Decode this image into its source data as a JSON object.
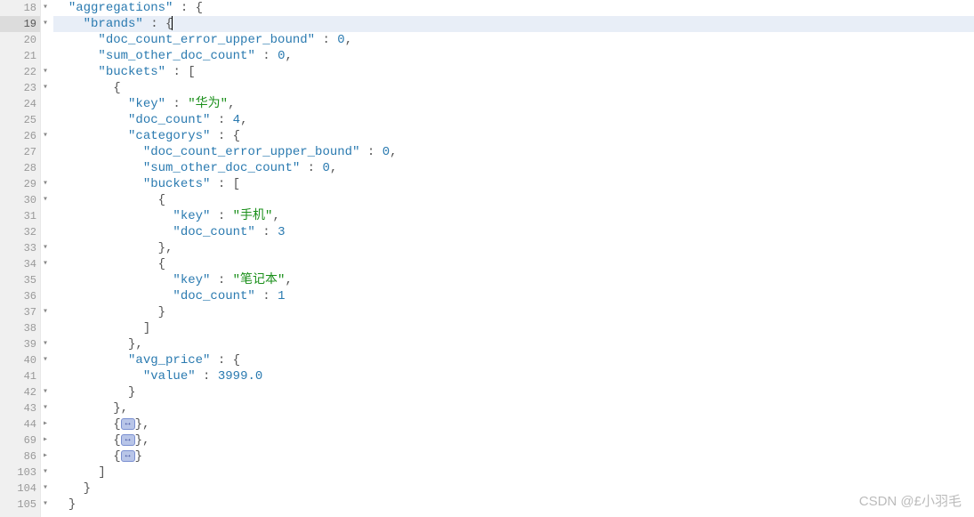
{
  "watermark": "CSDN @£小羽毛",
  "fold_badge": "↔",
  "gutter": [
    {
      "num": "18",
      "fold": "▾"
    },
    {
      "num": "19",
      "fold": "▾",
      "active": true
    },
    {
      "num": "20"
    },
    {
      "num": "21"
    },
    {
      "num": "22",
      "fold": "▾"
    },
    {
      "num": "23",
      "fold": "▾"
    },
    {
      "num": "24"
    },
    {
      "num": "25"
    },
    {
      "num": "26",
      "fold": "▾"
    },
    {
      "num": "27"
    },
    {
      "num": "28"
    },
    {
      "num": "29",
      "fold": "▾"
    },
    {
      "num": "30",
      "fold": "▾"
    },
    {
      "num": "31"
    },
    {
      "num": "32"
    },
    {
      "num": "33",
      "fold": "▾"
    },
    {
      "num": "34",
      "fold": "▾"
    },
    {
      "num": "35"
    },
    {
      "num": "36"
    },
    {
      "num": "37",
      "fold": "▾"
    },
    {
      "num": "38"
    },
    {
      "num": "39",
      "fold": "▾"
    },
    {
      "num": "40",
      "fold": "▾"
    },
    {
      "num": "41"
    },
    {
      "num": "42",
      "fold": "▾"
    },
    {
      "num": "43",
      "fold": "▾"
    },
    {
      "num": "44",
      "fold": "▸"
    },
    {
      "num": "69",
      "fold": "▸"
    },
    {
      "num": "86",
      "fold": "▸"
    },
    {
      "num": "103",
      "fold": "▾"
    },
    {
      "num": "104",
      "fold": "▾"
    },
    {
      "num": "105",
      "fold": "▾"
    }
  ],
  "lines": [
    {
      "indent": 2,
      "tokens": [
        [
          "key",
          "\"aggregations\""
        ],
        [
          "punc",
          " : {"
        ]
      ]
    },
    {
      "indent": 4,
      "active": true,
      "tokens": [
        [
          "key",
          "\"brands\""
        ],
        [
          "punc",
          " : {"
        ],
        [
          "cursor",
          ""
        ]
      ]
    },
    {
      "indent": 6,
      "tokens": [
        [
          "key",
          "\"doc_count_error_upper_bound\""
        ],
        [
          "punc",
          " : "
        ],
        [
          "num",
          "0"
        ],
        [
          "punc",
          ","
        ]
      ]
    },
    {
      "indent": 6,
      "tokens": [
        [
          "key",
          "\"sum_other_doc_count\""
        ],
        [
          "punc",
          " : "
        ],
        [
          "num",
          "0"
        ],
        [
          "punc",
          ","
        ]
      ]
    },
    {
      "indent": 6,
      "tokens": [
        [
          "key",
          "\"buckets\""
        ],
        [
          "punc",
          " : ["
        ]
      ]
    },
    {
      "indent": 8,
      "tokens": [
        [
          "punc",
          "{"
        ]
      ]
    },
    {
      "indent": 10,
      "tokens": [
        [
          "key",
          "\"key\""
        ],
        [
          "punc",
          " : "
        ],
        [
          "string",
          "\"华为\""
        ],
        [
          "punc",
          ","
        ]
      ]
    },
    {
      "indent": 10,
      "tokens": [
        [
          "key",
          "\"doc_count\""
        ],
        [
          "punc",
          " : "
        ],
        [
          "num",
          "4"
        ],
        [
          "punc",
          ","
        ]
      ]
    },
    {
      "indent": 10,
      "tokens": [
        [
          "key",
          "\"categorys\""
        ],
        [
          "punc",
          " : {"
        ]
      ]
    },
    {
      "indent": 12,
      "tokens": [
        [
          "key",
          "\"doc_count_error_upper_bound\""
        ],
        [
          "punc",
          " : "
        ],
        [
          "num",
          "0"
        ],
        [
          "punc",
          ","
        ]
      ]
    },
    {
      "indent": 12,
      "tokens": [
        [
          "key",
          "\"sum_other_doc_count\""
        ],
        [
          "punc",
          " : "
        ],
        [
          "num",
          "0"
        ],
        [
          "punc",
          ","
        ]
      ]
    },
    {
      "indent": 12,
      "tokens": [
        [
          "key",
          "\"buckets\""
        ],
        [
          "punc",
          " : ["
        ]
      ]
    },
    {
      "indent": 14,
      "tokens": [
        [
          "punc",
          "{"
        ]
      ]
    },
    {
      "indent": 16,
      "tokens": [
        [
          "key",
          "\"key\""
        ],
        [
          "punc",
          " : "
        ],
        [
          "string",
          "\"手机\""
        ],
        [
          "punc",
          ","
        ]
      ]
    },
    {
      "indent": 16,
      "tokens": [
        [
          "key",
          "\"doc_count\""
        ],
        [
          "punc",
          " : "
        ],
        [
          "num",
          "3"
        ]
      ]
    },
    {
      "indent": 14,
      "tokens": [
        [
          "punc",
          "},"
        ]
      ]
    },
    {
      "indent": 14,
      "tokens": [
        [
          "punc",
          "{"
        ]
      ]
    },
    {
      "indent": 16,
      "tokens": [
        [
          "key",
          "\"key\""
        ],
        [
          "punc",
          " : "
        ],
        [
          "string",
          "\"笔记本\""
        ],
        [
          "punc",
          ","
        ]
      ]
    },
    {
      "indent": 16,
      "tokens": [
        [
          "key",
          "\"doc_count\""
        ],
        [
          "punc",
          " : "
        ],
        [
          "num",
          "1"
        ]
      ]
    },
    {
      "indent": 14,
      "tokens": [
        [
          "punc",
          "}"
        ]
      ]
    },
    {
      "indent": 12,
      "tokens": [
        [
          "punc",
          "]"
        ]
      ]
    },
    {
      "indent": 10,
      "tokens": [
        [
          "punc",
          "},"
        ]
      ]
    },
    {
      "indent": 10,
      "tokens": [
        [
          "key",
          "\"avg_price\""
        ],
        [
          "punc",
          " : {"
        ]
      ]
    },
    {
      "indent": 12,
      "tokens": [
        [
          "key",
          "\"value\""
        ],
        [
          "punc",
          " : "
        ],
        [
          "num",
          "3999.0"
        ]
      ]
    },
    {
      "indent": 10,
      "tokens": [
        [
          "punc",
          "}"
        ]
      ]
    },
    {
      "indent": 8,
      "tokens": [
        [
          "punc",
          "},"
        ]
      ]
    },
    {
      "indent": 8,
      "tokens": [
        [
          "punc",
          "{"
        ],
        [
          "fold",
          ""
        ],
        [
          "punc",
          "},"
        ]
      ]
    },
    {
      "indent": 8,
      "tokens": [
        [
          "punc",
          "{"
        ],
        [
          "fold",
          ""
        ],
        [
          "punc",
          "},"
        ]
      ]
    },
    {
      "indent": 8,
      "tokens": [
        [
          "punc",
          "{"
        ],
        [
          "fold",
          ""
        ],
        [
          "punc",
          "}"
        ]
      ]
    },
    {
      "indent": 6,
      "tokens": [
        [
          "punc",
          "]"
        ]
      ]
    },
    {
      "indent": 4,
      "tokens": [
        [
          "punc",
          "}"
        ]
      ]
    },
    {
      "indent": 2,
      "tokens": [
        [
          "punc",
          "}"
        ]
      ]
    }
  ]
}
